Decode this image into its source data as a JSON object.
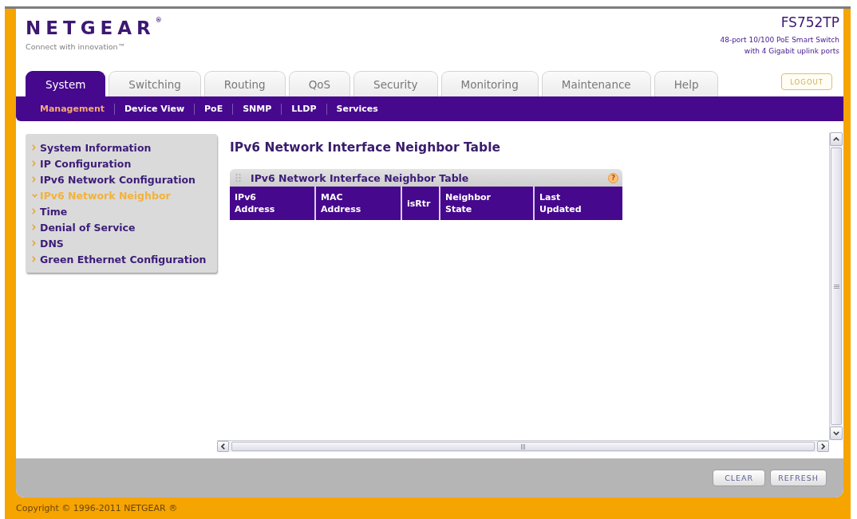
{
  "header": {
    "logo": "NETGEAR$^{®}$",
    "tagline": "Connect with innovation™",
    "model": "FS752TP",
    "description": [
      "48-port 10/100 PoE Smart Switch",
      "with 4 Gigabit uplink ports"
    ]
  },
  "tabs": [
    {
      "label": "System",
      "selected": true
    },
    {
      "label": "Switching",
      "selected": false
    },
    {
      "label": "Routing",
      "selected": false
    },
    {
      "label": "QoS",
      "selected": false
    },
    {
      "label": "Security",
      "selected": false
    },
    {
      "label": "Monitoring",
      "selected": false
    },
    {
      "label": "Maintenance",
      "selected": false
    },
    {
      "label": "Help",
      "selected": false
    }
  ],
  "logout_button": "LOGOUT",
  "subnav": [
    {
      "label": "Management",
      "selected": true
    },
    {
      "label": "Device View",
      "selected": false
    },
    {
      "label": "PoE",
      "selected": false
    },
    {
      "label": "SNMP",
      "selected": false
    },
    {
      "label": "LLDP",
      "selected": false
    },
    {
      "label": "Services",
      "selected": false
    }
  ],
  "sidebar": {
    "items": [
      {
        "label": "System Information",
        "selected": false
      },
      {
        "label": "IP Configuration",
        "selected": false
      },
      {
        "label": "IPv6 Network Configuration",
        "selected": false
      },
      {
        "label": "IPv6 Network Neighbor",
        "selected": true
      },
      {
        "label": "Time",
        "selected": false
      },
      {
        "label": "Denial of Service",
        "selected": false
      },
      {
        "label": "DNS",
        "selected": false
      },
      {
        "label": "Green Ethernet Configuration",
        "selected": false
      }
    ]
  },
  "content": {
    "title": "IPv6 Network Interface Neighbor Table",
    "table": {
      "title": "IPv6 Network Interface Neighbor Table",
      "help": "?",
      "columns": [
        "IPv6 Address",
        "MAC Address",
        "isRtr",
        "Neighbor State",
        "Last Updated"
      ]
    }
  },
  "buttons": [
    "CLEAR",
    "REFRESH"
  ],
  "copyright": "Copyright © 1996-2011 NETGEAR ®"
}
